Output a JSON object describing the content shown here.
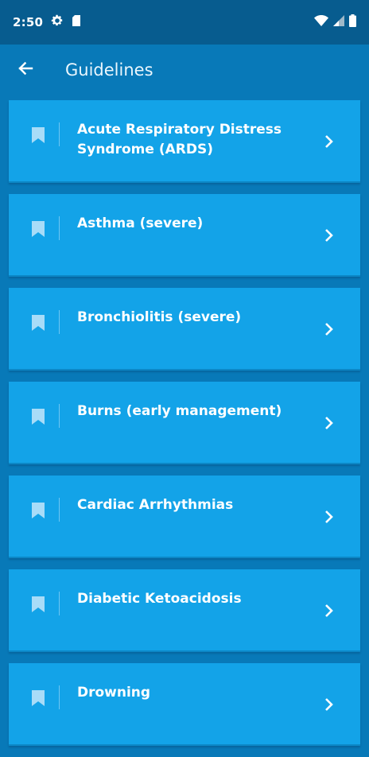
{
  "status_bar": {
    "time": "2:50",
    "icons": [
      "gear-icon",
      "sd-card-icon",
      "wifi-icon",
      "signal-icon",
      "battery-icon"
    ]
  },
  "app_bar": {
    "title": "Guidelines",
    "back_icon": "arrow-left-icon"
  },
  "guidelines": [
    {
      "label": "Acute Respiratory Distress Syndrome (ARDS)"
    },
    {
      "label": "Asthma (severe)"
    },
    {
      "label": "Bronchiolitis (severe)"
    },
    {
      "label": "Burns (early management)"
    },
    {
      "label": "Cardiac Arrhythmias"
    },
    {
      "label": "Diabetic Ketoacidosis"
    },
    {
      "label": "Drowning"
    }
  ],
  "colors": {
    "status_bar": "#075c8f",
    "background": "#0879b8",
    "card": "#13a3e8",
    "bookmark": "#a8dcf8"
  }
}
